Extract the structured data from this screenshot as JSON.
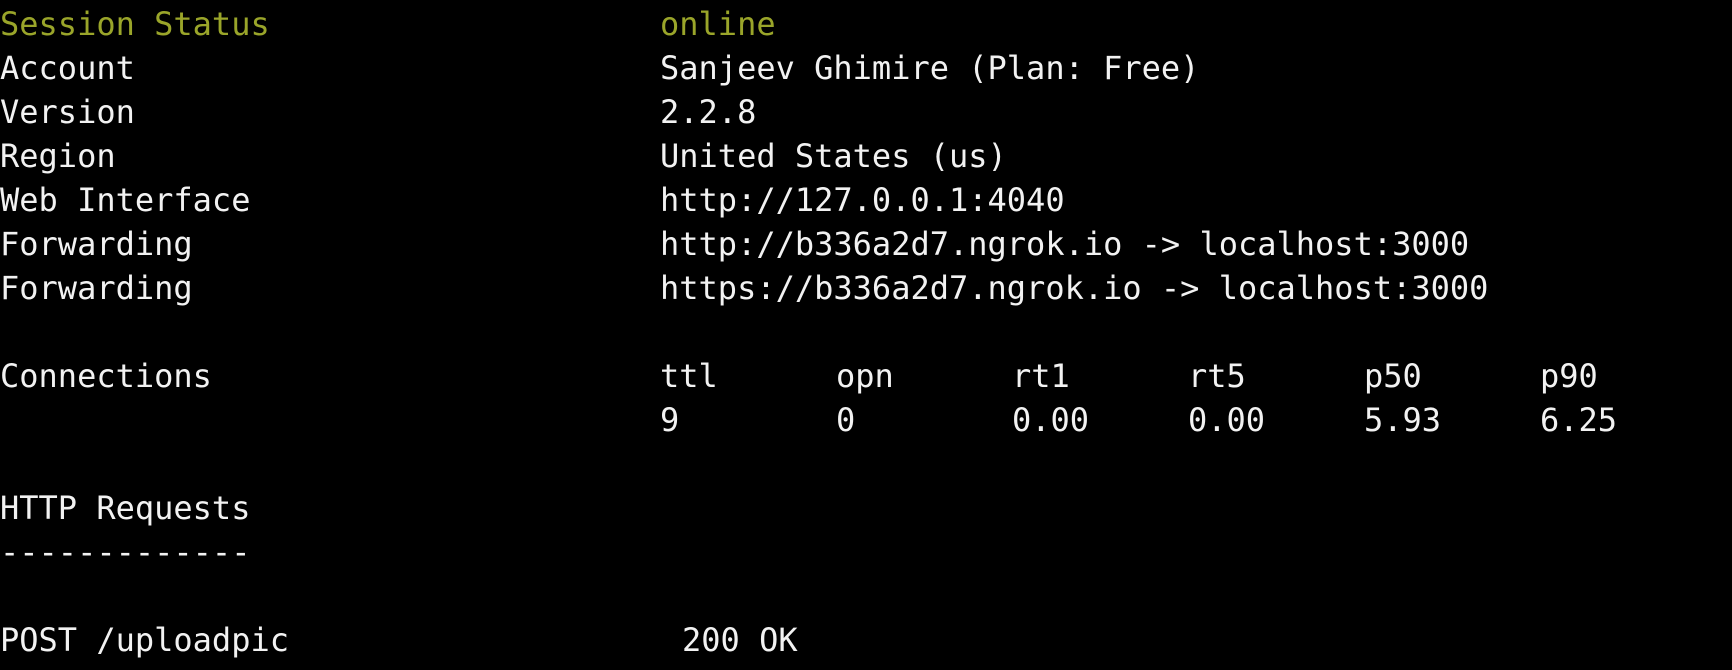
{
  "session": {
    "status_label": "Session Status",
    "status_value": "online"
  },
  "info": [
    {
      "label": "Account",
      "value": "Sanjeev Ghimire (Plan: Free)"
    },
    {
      "label": "Version",
      "value": "2.2.8"
    },
    {
      "label": "Region",
      "value": "United States (us)"
    },
    {
      "label": "Web Interface",
      "value": "http://127.0.0.1:4040"
    },
    {
      "label": "Forwarding",
      "value": "http://b336a2d7.ngrok.io -> localhost:3000"
    },
    {
      "label": "Forwarding",
      "value": "https://b336a2d7.ngrok.io -> localhost:3000"
    }
  ],
  "connections": {
    "label": "Connections",
    "headers": [
      "ttl",
      "opn",
      "rt1",
      "rt5",
      "p50",
      "p90"
    ],
    "values": [
      "9",
      "0",
      "0.00",
      "0.00",
      "5.93",
      "6.25"
    ]
  },
  "http_requests": {
    "title": "HTTP Requests",
    "divider": "-------------",
    "requests": [
      {
        "request": "POST /uploadpic",
        "status": "200 OK"
      }
    ]
  },
  "colors": {
    "background": "#000000",
    "text": "#f2f2f2",
    "status_green": "#9aa52a"
  }
}
